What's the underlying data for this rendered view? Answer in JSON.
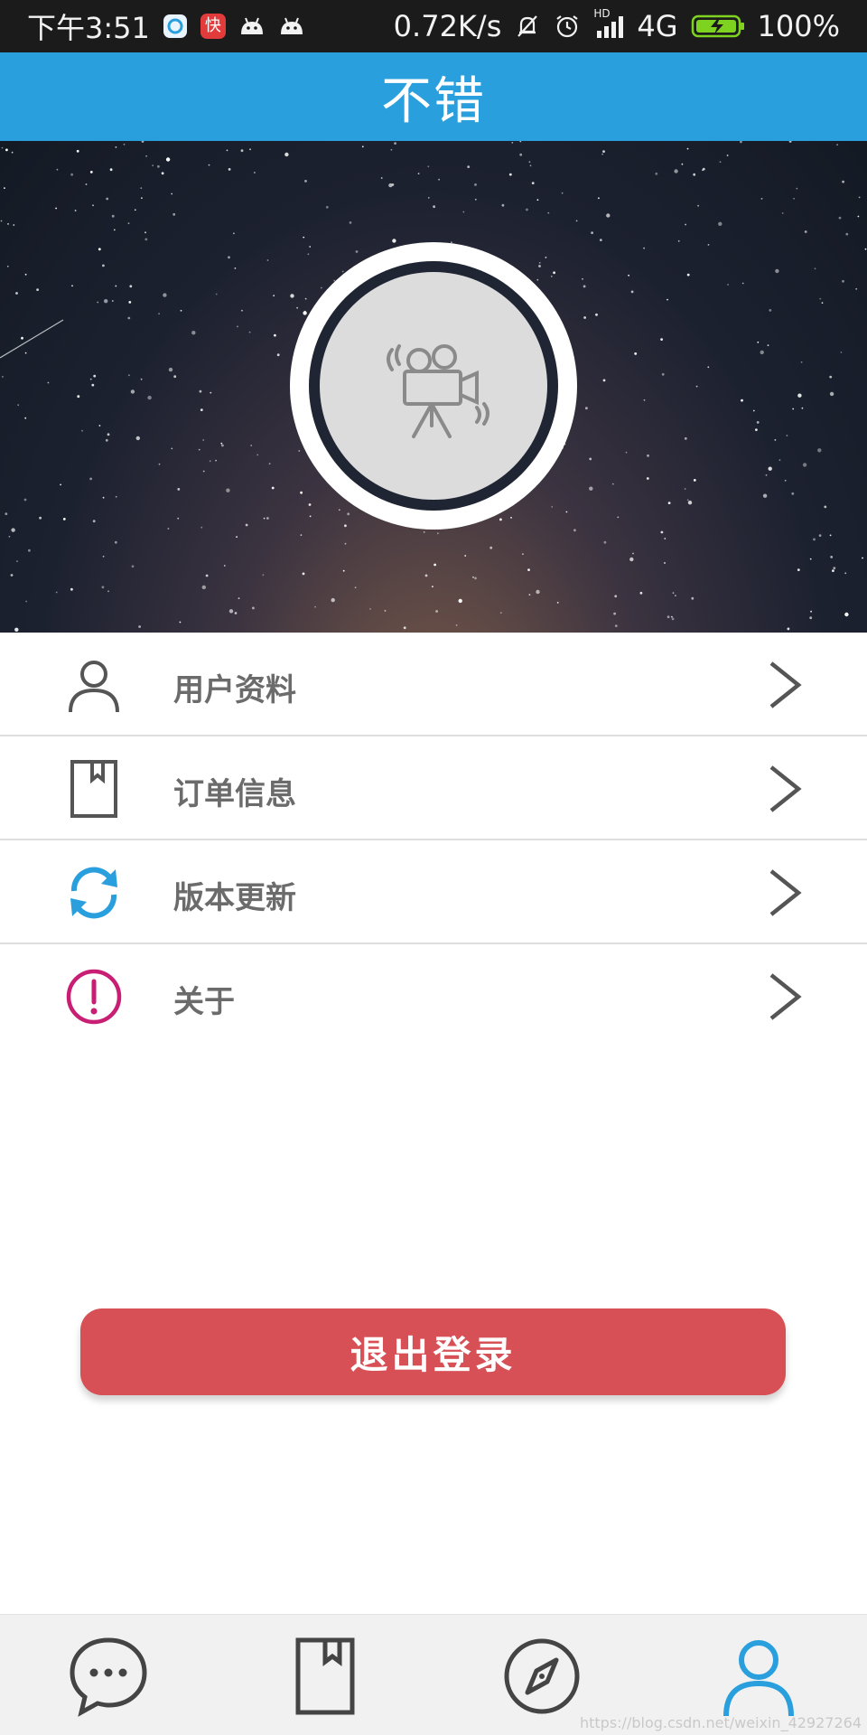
{
  "status_bar": {
    "time": "下午3:51",
    "net_speed": "0.72K/s",
    "hd_label": "HD",
    "network": "4G",
    "battery_percent": "100%",
    "app_icons": [
      "qq-browser-icon",
      "kuaishou-icon",
      "android-icon",
      "android-icon"
    ],
    "kuaishou_char": "快"
  },
  "header": {
    "title": "不错"
  },
  "menu": {
    "items": [
      {
        "label": "用户资料",
        "icon": "user-icon"
      },
      {
        "label": "订单信息",
        "icon": "bookmark-icon"
      },
      {
        "label": "版本更新",
        "icon": "refresh-icon"
      },
      {
        "label": "关于",
        "icon": "info-icon"
      }
    ]
  },
  "logout": {
    "label": "退出登录"
  },
  "bottom_nav": {
    "items": [
      {
        "icon": "chat-icon"
      },
      {
        "icon": "bookmark-icon"
      },
      {
        "icon": "compass-icon"
      },
      {
        "icon": "user-icon",
        "active": true
      }
    ]
  },
  "watermark": "https://blog.csdn.net/weixin_42927264",
  "colors": {
    "title_bar": "#2a9fdd",
    "logout_button": "#d75055",
    "refresh_icon": "#2a9fdd",
    "info_icon": "#c81e73",
    "active_nav": "#2a9fdd"
  }
}
